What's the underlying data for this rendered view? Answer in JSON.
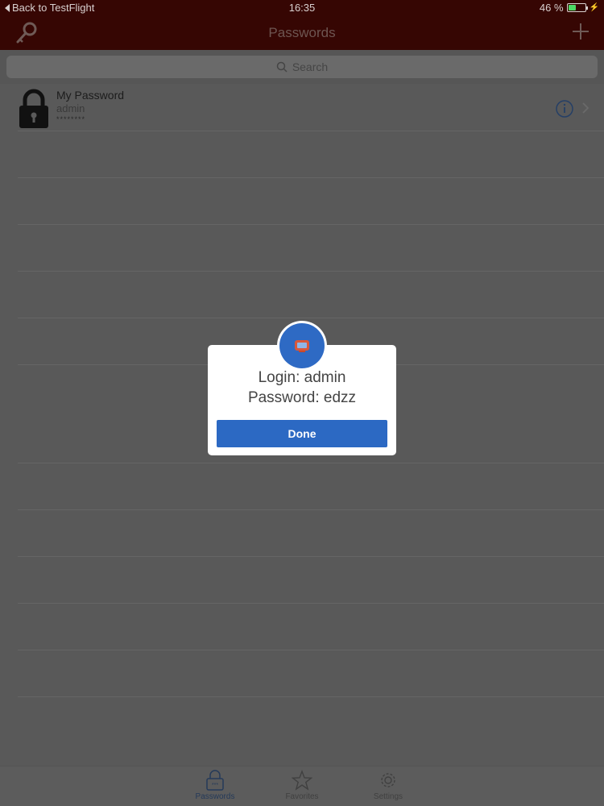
{
  "status_bar": {
    "back_label": "Back to TestFlight",
    "time": "16:35",
    "battery": "46 %",
    "battery_level": 0.46
  },
  "nav": {
    "title": "Passwords",
    "left_icon": "key-icon",
    "right_icon": "plus-icon"
  },
  "search": {
    "placeholder": "Search"
  },
  "list": {
    "items": [
      {
        "name": "My Password",
        "username": "admin",
        "masked_password": "********",
        "icon": "lock-icon"
      }
    ]
  },
  "alert": {
    "line1": "Login: admin",
    "line2": "Password: edzz",
    "button": "Done",
    "icon": "app-icon"
  },
  "tabs": [
    {
      "label": "Passwords",
      "icon": "lock-icon",
      "active": true
    },
    {
      "label": "Favorites",
      "icon": "star-icon",
      "active": false
    },
    {
      "label": "Settings",
      "icon": "gear-icon",
      "active": false
    }
  ],
  "colors": {
    "nav_background": "#360603",
    "accent": "#2c69c3",
    "battery_fill": "#4cd964"
  }
}
